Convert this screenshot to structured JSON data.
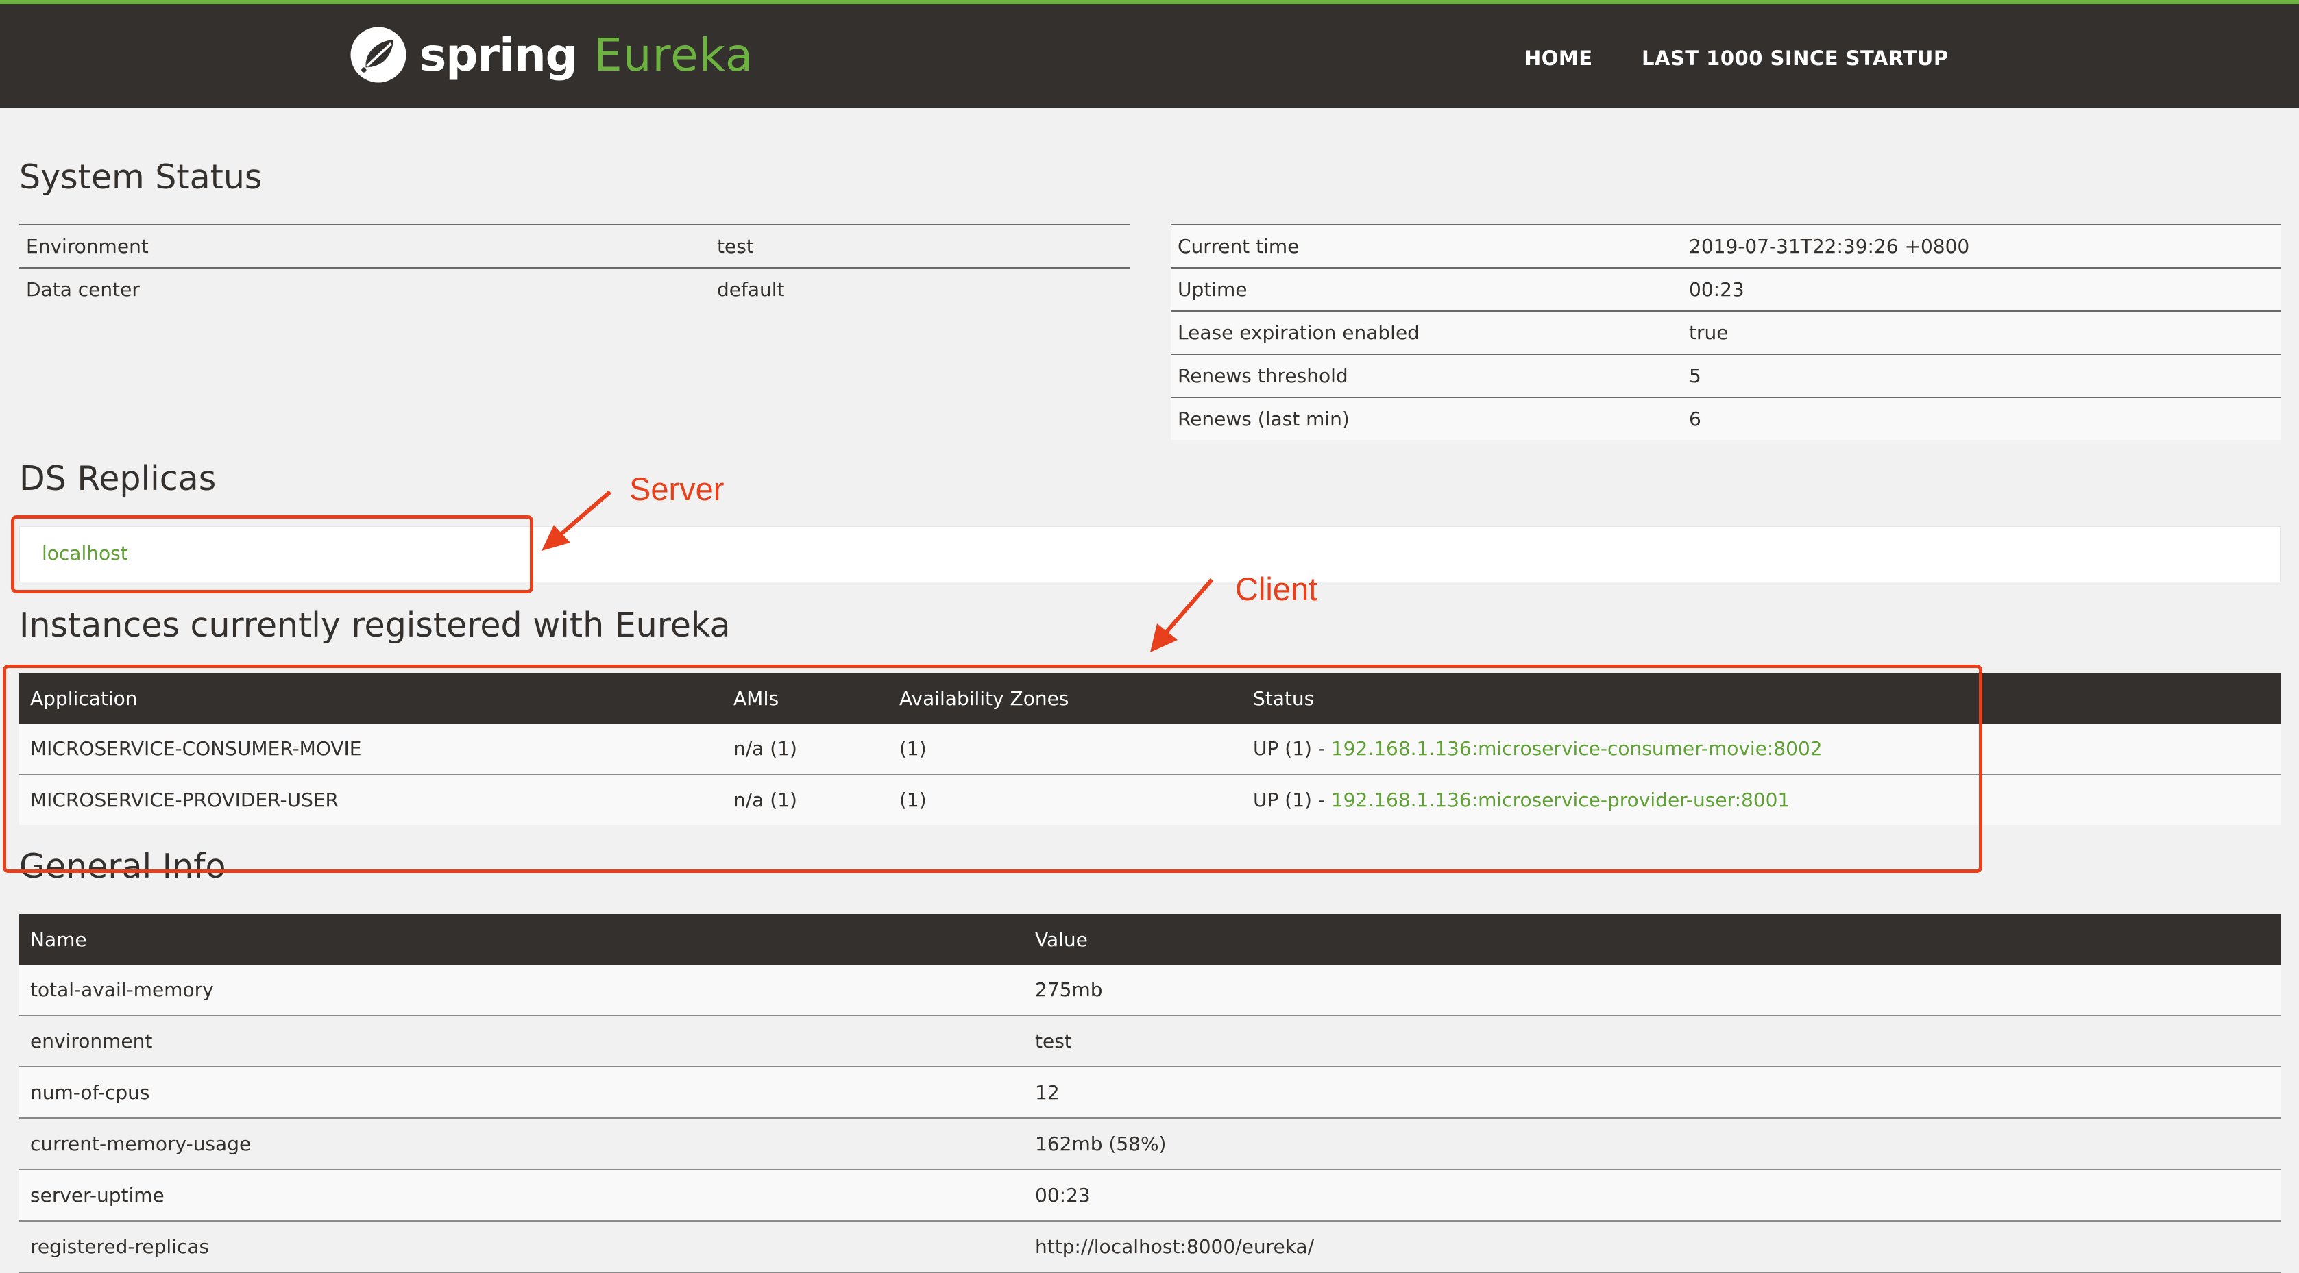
{
  "nav": {
    "logo_spring": "spring",
    "logo_eureka": "Eureka",
    "home": "HOME",
    "last_1000": "LAST 1000 SINCE STARTUP"
  },
  "system_status": {
    "title": "System Status",
    "left": [
      {
        "label": "Environment",
        "value": "test"
      },
      {
        "label": "Data center",
        "value": "default"
      }
    ],
    "right": [
      {
        "label": "Current time",
        "value": "2019-07-31T22:39:26 +0800"
      },
      {
        "label": "Uptime",
        "value": "00:23"
      },
      {
        "label": "Lease expiration enabled",
        "value": "true"
      },
      {
        "label": "Renews threshold",
        "value": "5"
      },
      {
        "label": "Renews (last min)",
        "value": "6"
      }
    ]
  },
  "ds_replicas": {
    "title": "DS Replicas",
    "replica": "localhost"
  },
  "instances": {
    "title": "Instances currently registered with Eureka",
    "headers": [
      "Application",
      "AMIs",
      "Availability Zones",
      "Status"
    ],
    "rows": [
      {
        "application": "MICROSERVICE-CONSUMER-MOVIE",
        "amis": "n/a (1)",
        "zones": "(1)",
        "status_prefix": "UP (1) - ",
        "status_link": "192.168.1.136:microservice-consumer-movie:8002"
      },
      {
        "application": "MICROSERVICE-PROVIDER-USER",
        "amis": "n/a (1)",
        "zones": "(1)",
        "status_prefix": "UP (1) - ",
        "status_link": "192.168.1.136:microservice-provider-user:8001"
      }
    ]
  },
  "general_info": {
    "title": "General Info",
    "headers": [
      "Name",
      "Value"
    ],
    "rows": [
      {
        "name": "total-avail-memory",
        "value": "275mb"
      },
      {
        "name": "environment",
        "value": "test"
      },
      {
        "name": "num-of-cpus",
        "value": "12"
      },
      {
        "name": "current-memory-usage",
        "value": "162mb (58%)"
      },
      {
        "name": "server-uptime",
        "value": "00:23"
      },
      {
        "name": "registered-replicas",
        "value": "http://localhost:8000/eureka/"
      }
    ]
  },
  "annotations": {
    "server": "Server",
    "client": "Client",
    "color": "#e8401c"
  },
  "colors": {
    "navbar": "#34302d",
    "accent_green": "#6db33f",
    "link_green": "#5fa134",
    "background": "#f1f1f1"
  }
}
